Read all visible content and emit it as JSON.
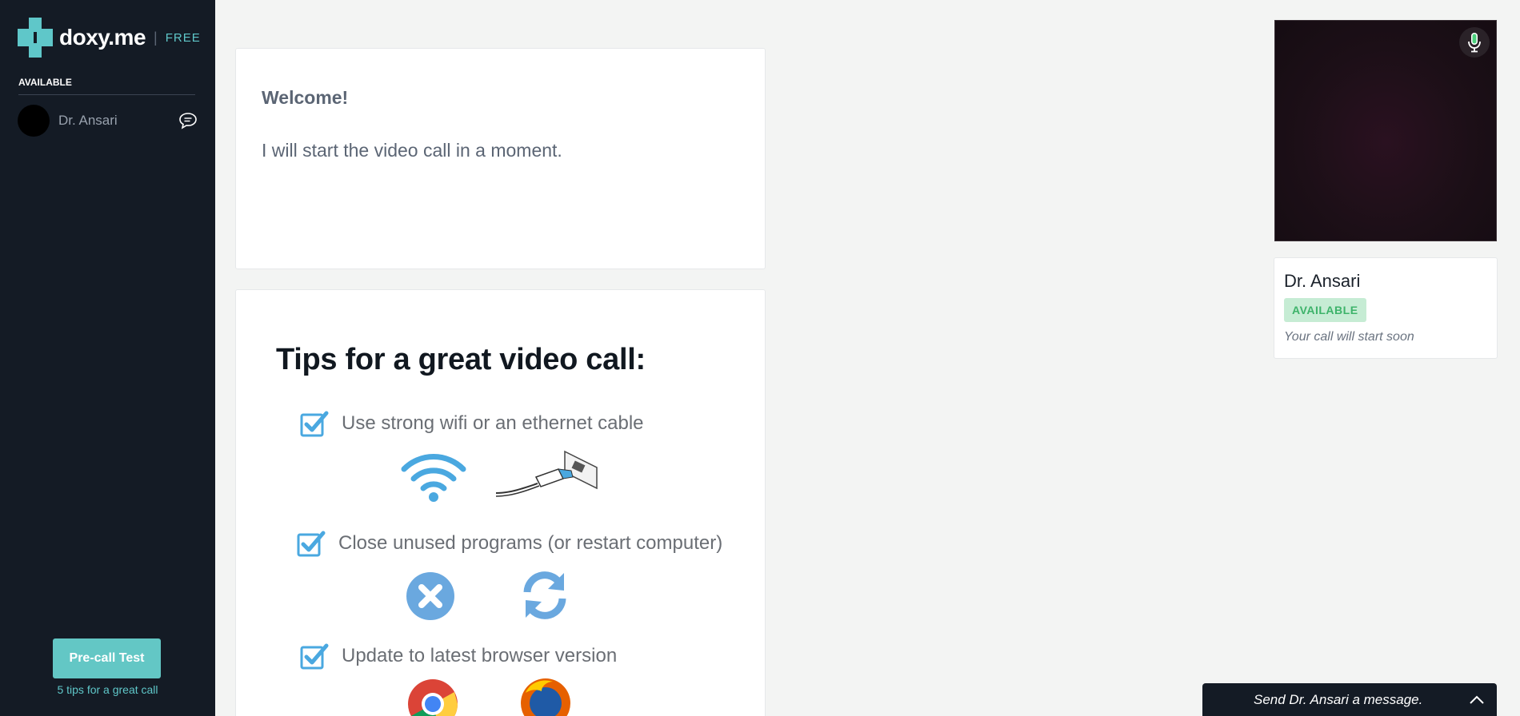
{
  "brand": {
    "name": "doxy.me",
    "plan": "FREE",
    "accent": "#5fc7c9"
  },
  "sidebar": {
    "section_label": "AVAILABLE",
    "providers": [
      {
        "name": "Dr. Ansari",
        "icon": "chat-bubble-icon"
      }
    ],
    "precall_button": "Pre-call Test",
    "tips_link": "5 tips for a great call"
  },
  "welcome": {
    "title": "Welcome!",
    "message": "I will start the video call in a moment."
  },
  "tips": {
    "title": "Tips for a great video call:",
    "items": [
      {
        "text": "Use strong wifi or an ethernet cable",
        "icons": [
          "wifi-icon",
          "ethernet-cable-icon"
        ]
      },
      {
        "text": "Close unused programs (or restart computer)",
        "icons": [
          "close-circle-icon",
          "refresh-icon"
        ]
      },
      {
        "text": "Update to latest browser version",
        "icons": [
          "chrome-icon",
          "firefox-icon"
        ]
      }
    ]
  },
  "provider_card": {
    "name": "Dr. Ansari",
    "status_badge": "AVAILABLE",
    "status_text": "Your call will start soon",
    "badge_color": "#3db36a"
  },
  "message_bar": {
    "label": "Send Dr. Ansari a message."
  }
}
